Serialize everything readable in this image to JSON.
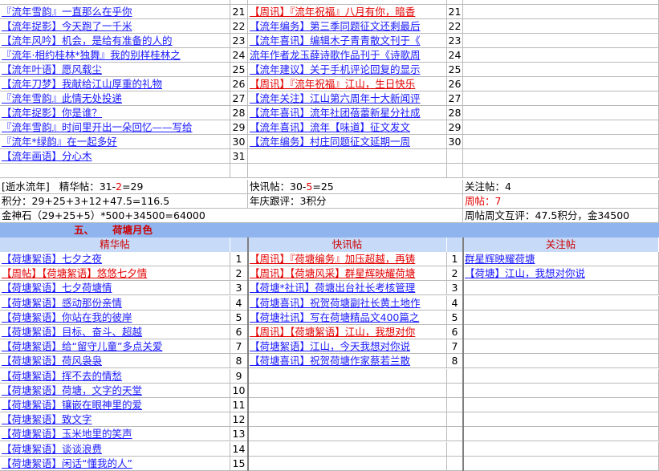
{
  "top_rows": [
    {
      "a": "『流年雪韵』一直那么在乎你",
      "a_style": "link",
      "n1": "21",
      "b": "【周讯】『流年祝福』八月有你，暗香",
      "b_style": "red",
      "n2": "21"
    },
    {
      "a": "【流年捉影】今天跑了一千米",
      "a_style": "link",
      "n1": "22",
      "b": "【流年编务】第三季同题征文还剩最后",
      "b_style": "link",
      "n2": "22"
    },
    {
      "a": "【流年风吟】机会，是给有准备的人的",
      "a_style": "link",
      "n1": "23",
      "b": "【流年喜讯】编辑木子青青散文刊于《",
      "b_style": "link",
      "n2": "23"
    },
    {
      "a": "『流年·相约桂林*独舞』我的别样桂林之",
      "a_style": "link",
      "n1": "24",
      "b": "流年作者龙玉薛诗歌作品刊于《诗歌周",
      "b_style": "link",
      "n2": "24"
    },
    {
      "a": "【流年叶语】愿风载尘",
      "a_style": "link",
      "n1": "25",
      "b": "【流年建议】关于手机评论回复的显示",
      "b_style": "link",
      "n2": "25"
    },
    {
      "a": "【流年刀梦】我献给江山厚重的礼物",
      "a_style": "link",
      "n1": "26",
      "b": "【周讯】『流年祝福』江山，生日快乐",
      "b_style": "red",
      "n2": "26"
    },
    {
      "a": "『流年雪韵』此情无处投递",
      "a_style": "link",
      "n1": "27",
      "b": "【流年关注】江山第六周年十大新闻评",
      "b_style": "link",
      "n2": "27"
    },
    {
      "a": "【流年捉影】你是谁？",
      "a_style": "link",
      "n1": "28",
      "b": "【流年喜讯】流年社团蓓蕾新星分社成",
      "b_style": "link",
      "n2": "28"
    },
    {
      "a": "『流年雪韵』时间里开出一朵回忆——写给",
      "a_style": "link",
      "n1": "29",
      "b": "【流年喜讯】流年【味道】征文发文",
      "b_style": "link",
      "n2": "29"
    },
    {
      "a": "『流年*绿韵』在一起多好",
      "a_style": "link",
      "n1": "30",
      "b": "【流年编务】村庄同题征文延期一周",
      "b_style": "link",
      "n2": "30"
    },
    {
      "a": "【流年画语】分心木",
      "a_style": "link",
      "n1": "31",
      "b": "",
      "b_style": "link",
      "n2": ""
    }
  ],
  "summary": {
    "group": "[逝水流年]",
    "jinghua_label": "精华帖：31-",
    "jinghua_minus": "2",
    "jinghua_result": "=29",
    "kuaixun_label": "快讯帖：30-",
    "kuaixun_minus": "5",
    "kuaixun_result": "=25",
    "guanzhu": "关注帖：4",
    "score": "积分：29+25+3+12+47.5=116.5",
    "nianqing": "年庆跟评：3积分",
    "zhoutie": "周帖：7",
    "jinshen": "金神石（29+25+5）*500+34500=64000",
    "zhoutie_huping": "周帖周文互评：47.5积分，金34500"
  },
  "section": {
    "number": "五、",
    "title": "荷塘月色"
  },
  "headers": {
    "jinghua": "精华帖",
    "kuaixun": "快讯帖",
    "guanzhu": "关注帖"
  },
  "bottom_rows": [
    {
      "a": "【荷塘絮语】七夕之夜",
      "a_style": "link",
      "n1": "1",
      "b": "【周讯】『荷塘编务』加压超越，再铸",
      "b_style": "red",
      "n2": "1",
      "c": "群星辉映耀荷塘",
      "c_style": "link"
    },
    {
      "a": "【周帖】【荷塘絮语】悠悠七夕情",
      "a_style": "red",
      "n1": "2",
      "b": "【周讯】【荷塘风采】群星辉映耀荷塘",
      "b_style": "red",
      "n2": "2",
      "c": "【荷塘】江山，我想对你说",
      "c_style": "link"
    },
    {
      "a": "【荷塘絮语】七夕荷塘情",
      "a_style": "link",
      "n1": "3",
      "b": "【荷塘*社讯】荷塘出台社长考核管理",
      "b_style": "link",
      "n2": "3",
      "c": "",
      "c_style": "link"
    },
    {
      "a": "【荷塘絮语】感动那份亲情",
      "a_style": "link",
      "n1": "4",
      "b": "【荷塘喜讯】祝贺荷塘副社长黄土地作",
      "b_style": "link",
      "n2": "4",
      "c": "",
      "c_style": "link"
    },
    {
      "a": "【荷塘絮语】你站在我的彼岸",
      "a_style": "link",
      "n1": "5",
      "b": "【荷塘社讯】写在荷塘精品文400篇之",
      "b_style": "link",
      "n2": "5",
      "c": "",
      "c_style": "link"
    },
    {
      "a": "【荷塘絮语】目标、奋斗、超越",
      "a_style": "link",
      "n1": "6",
      "b": "【周讯】【荷塘絮语】江山，我想对你",
      "b_style": "red",
      "n2": "6",
      "c": "",
      "c_style": "link"
    },
    {
      "a": "【荷塘絮语】给“留守儿童”多点关爱",
      "a_style": "link",
      "n1": "7",
      "b": "【荷塘絮语】江山，今天我想对你说",
      "b_style": "link",
      "n2": "7",
      "c": "",
      "c_style": "link"
    },
    {
      "a": "【荷塘絮语】荷风袅袅",
      "a_style": "link",
      "n1": "8",
      "b": "【荷塘喜讯】祝贺荷塘作家蔡若兰散",
      "b_style": "link",
      "n2": "8",
      "c": "",
      "c_style": "link"
    },
    {
      "a": "【荷塘絮语】挥不去的情愁",
      "a_style": "link",
      "n1": "9",
      "b": "",
      "b_style": "link",
      "n2": "",
      "c": "",
      "c_style": "link"
    },
    {
      "a": "【荷塘絮语】荷塘，文字的天堂",
      "a_style": "link",
      "n1": "10",
      "b": "",
      "b_style": "link",
      "n2": "",
      "c": "",
      "c_style": "link"
    },
    {
      "a": "【荷塘絮语】镶嵌在眼神里的爱",
      "a_style": "link",
      "n1": "11",
      "b": "",
      "b_style": "link",
      "n2": "",
      "c": "",
      "c_style": "link"
    },
    {
      "a": "【荷塘絮语】致文字",
      "a_style": "link",
      "n1": "12",
      "b": "",
      "b_style": "link",
      "n2": "",
      "c": "",
      "c_style": "link"
    },
    {
      "a": "【荷塘絮语】玉米地里的笑声",
      "a_style": "link",
      "n1": "13",
      "b": "",
      "b_style": "link",
      "n2": "",
      "c": "",
      "c_style": "link"
    },
    {
      "a": "【荷塘絮语】谈谈浪费",
      "a_style": "link",
      "n1": "14",
      "b": "",
      "b_style": "link",
      "n2": "",
      "c": "",
      "c_style": "link"
    },
    {
      "a": "【荷塘絮语】闲话“懂我的人”",
      "a_style": "link",
      "n1": "15",
      "b": "",
      "b_style": "link",
      "n2": "",
      "c": "",
      "c_style": "link"
    }
  ]
}
